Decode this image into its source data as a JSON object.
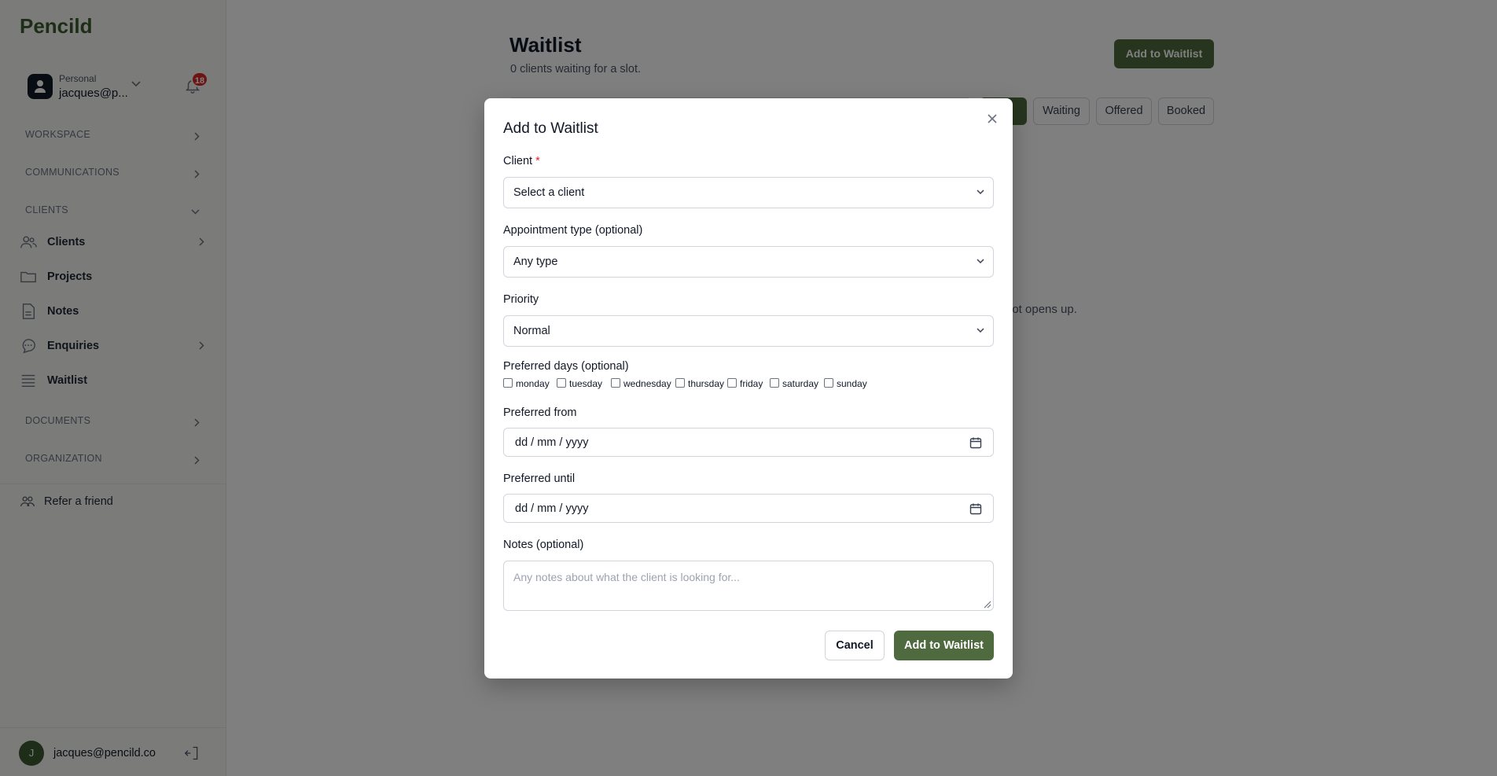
{
  "app": {
    "name": "Pencild"
  },
  "account": {
    "kind": "Personal",
    "email": "jacques@p...",
    "notifications": "18"
  },
  "sidebar": {
    "sections": {
      "workspace": "WORKSPACE",
      "communications": "COMMUNICATIONS",
      "clients": "CLIENTS",
      "documents": "DOCUMENTS",
      "organization": "ORGANIZATION"
    },
    "items": [
      {
        "label": "Clients",
        "icon": "users-icon"
      },
      {
        "label": "Projects",
        "icon": "folder-icon"
      },
      {
        "label": "Notes",
        "icon": "document-icon"
      },
      {
        "label": "Enquiries",
        "icon": "chat-icon"
      },
      {
        "label": "Waitlist",
        "icon": "list-icon"
      }
    ],
    "refer": "Refer a friend",
    "footer": {
      "avatar_initial": "J",
      "email": "jacques@pencild.co"
    }
  },
  "page": {
    "title": "Waitlist",
    "subtitle": "0 clients waiting for a slot.",
    "add_button": "Add to Waitlist",
    "filters": [
      "Waiting",
      "Offered",
      "Booked"
    ],
    "active_filter_partial": "e",
    "empty_text_partial": "lot opens up."
  },
  "modal": {
    "title": "Add to Waitlist",
    "client": {
      "label": "Client",
      "required_mark": "*",
      "value": "Select a client"
    },
    "appointment_type": {
      "label": "Appointment type (optional)",
      "value": "Any type"
    },
    "priority": {
      "label": "Priority",
      "value": "Normal"
    },
    "preferred_days": {
      "label": "Preferred days (optional)",
      "days": [
        "monday",
        "tuesday",
        "wednesday",
        "thursday",
        "friday",
        "saturday",
        "sunday"
      ]
    },
    "preferred_from": {
      "label": "Preferred from",
      "value": "dd / mm / yyyy"
    },
    "preferred_until": {
      "label": "Preferred until",
      "value": "dd / mm / yyyy"
    },
    "notes": {
      "label": "Notes (optional)",
      "placeholder": "Any notes about what the client is looking for..."
    },
    "cancel": "Cancel",
    "submit": "Add to Waitlist"
  },
  "colors": {
    "brand": "#3d5a2e",
    "primary_button": "#4f6a3e",
    "badge": "#dc2626",
    "overlay": "rgba(0,0,0,0.5)"
  }
}
